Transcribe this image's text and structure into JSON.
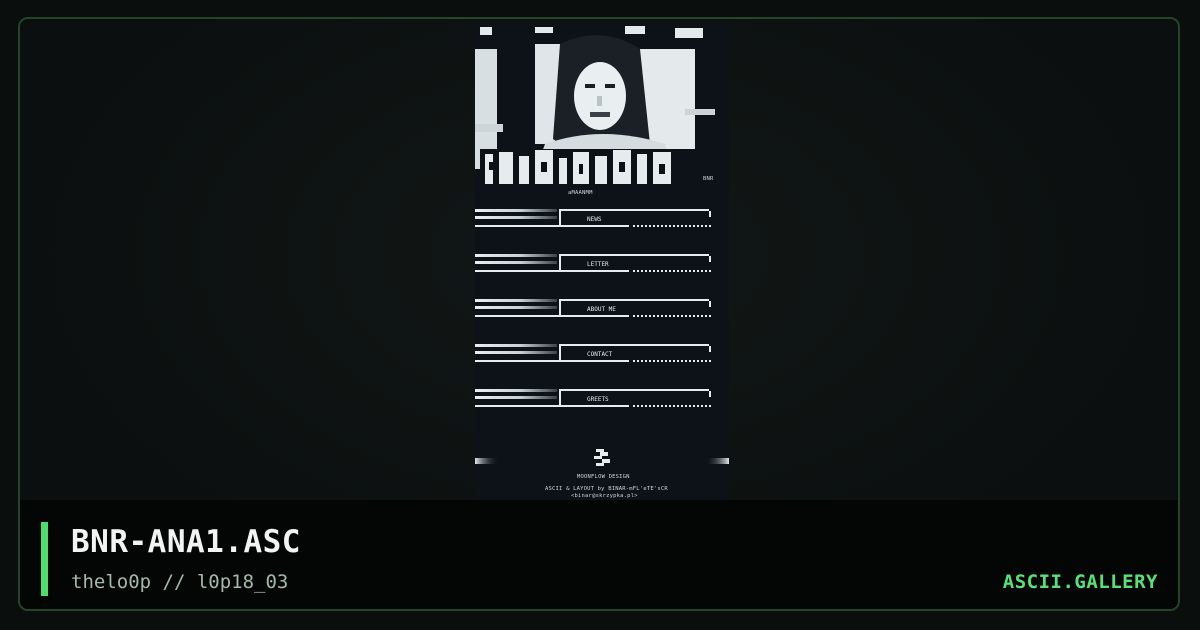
{
  "artwork": {
    "title": "BNR-ANA1.ASC",
    "author_line": "thelo0p // l0p18_03",
    "art_tag": "BNR",
    "art_signature": "aMAANMM",
    "menu": [
      {
        "label": "NEWS"
      },
      {
        "label": "LETTER"
      },
      {
        "label": "ABOUT ME"
      },
      {
        "label": "CONTACT"
      },
      {
        "label": "GREETS"
      }
    ],
    "footer_logo_label": "MOONFLOW DESIGN",
    "footer_credit_1": "ASCII & LAYOUT by BINAR-mFL'eTE'sCR",
    "footer_credit_2": "<binar@skrzypka.pl>"
  },
  "brand": "ASCII.GALLERY",
  "colors": {
    "accent": "#4ce06a",
    "brand": "#59e07a",
    "frame_border": "#24452c"
  }
}
